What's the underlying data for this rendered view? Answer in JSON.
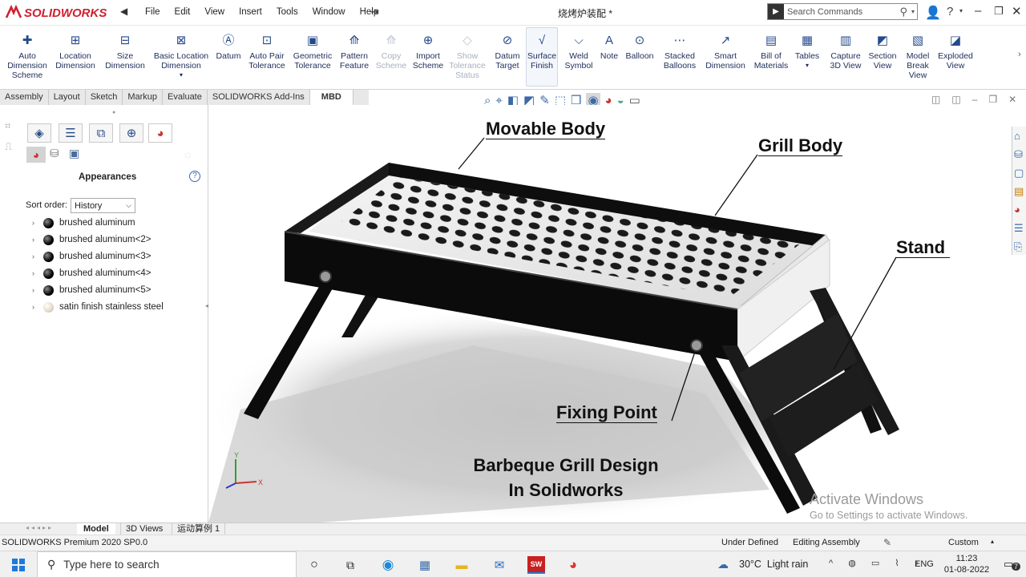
{
  "app": {
    "logo_text": "SOLIDWORKS",
    "document_title": "烧烤炉装配 *",
    "menu": [
      "File",
      "Edit",
      "View",
      "Insert",
      "Tools",
      "Window",
      "Help"
    ],
    "search_placeholder": "Search Commands"
  },
  "command_manager": {
    "tools": [
      {
        "label": "Auto Dimension Scheme",
        "icon": "auto-dimension-icon",
        "disabled": false
      },
      {
        "label": "Location Dimension",
        "icon": "location-dimension-icon",
        "disabled": false
      },
      {
        "label": "Size Dimension",
        "icon": "size-dimension-icon",
        "disabled": false
      },
      {
        "label": "Basic Location Dimension",
        "icon": "basic-location-dimension-icon",
        "disabled": false
      },
      {
        "label": "Datum",
        "icon": "datum-icon",
        "disabled": false
      },
      {
        "label": "Auto Pair Tolerance",
        "icon": "auto-pair-tolerance-icon",
        "disabled": false
      },
      {
        "label": "Geometric Tolerance",
        "icon": "geometric-tolerance-icon",
        "disabled": false
      },
      {
        "label": "Pattern Feature",
        "icon": "pattern-feature-icon",
        "disabled": false
      },
      {
        "label": "Copy Scheme",
        "icon": "copy-scheme-icon",
        "disabled": true
      },
      {
        "label": "Import Scheme",
        "icon": "import-scheme-icon",
        "disabled": false
      },
      {
        "label": "Show Tolerance Status",
        "icon": "show-tolerance-status-icon",
        "disabled": true
      },
      {
        "label": "Datum Target",
        "icon": "datum-target-icon",
        "disabled": false
      },
      {
        "label": "Surface Finish",
        "icon": "surface-finish-icon",
        "disabled": false
      },
      {
        "label": "Weld Symbol",
        "icon": "weld-symbol-icon",
        "disabled": false
      },
      {
        "label": "Note",
        "icon": "note-icon",
        "disabled": false
      },
      {
        "label": "Balloon",
        "icon": "balloon-icon",
        "disabled": false
      },
      {
        "label": "Stacked Balloons",
        "icon": "stacked-balloons-icon",
        "disabled": false
      },
      {
        "label": "Smart Dimension",
        "icon": "smart-dimension-icon",
        "disabled": false
      },
      {
        "label": "Bill of Materials",
        "icon": "bill-of-materials-icon",
        "disabled": false
      },
      {
        "label": "Tables",
        "icon": "tables-icon",
        "disabled": false
      },
      {
        "label": "Capture 3D View",
        "icon": "capture-3d-view-icon",
        "disabled": false
      },
      {
        "label": "Section View",
        "icon": "section-view-icon",
        "disabled": false
      },
      {
        "label": "Model Break View",
        "icon": "model-break-view-icon",
        "disabled": false
      },
      {
        "label": "Exploded View",
        "icon": "exploded-view-icon",
        "disabled": false
      }
    ]
  },
  "tabs": [
    "Assembly",
    "Layout",
    "Sketch",
    "Markup",
    "Evaluate",
    "SOLIDWORKS Add-Ins",
    "MBD"
  ],
  "active_tab": "MBD",
  "panel": {
    "title": "Appearances",
    "sort_label": "Sort order:",
    "sort_value": "History",
    "items": [
      {
        "label": "brushed aluminum",
        "type": "black"
      },
      {
        "label": "brushed aluminum<2>",
        "type": "black"
      },
      {
        "label": "brushed aluminum<3>",
        "type": "black"
      },
      {
        "label": "brushed aluminum<4>",
        "type": "black"
      },
      {
        "label": "brushed aluminum<5>",
        "type": "black"
      },
      {
        "label": "satin finish stainless steel",
        "type": "satin"
      }
    ]
  },
  "viewport": {
    "callouts": {
      "movable_body": "Movable Body",
      "grill_body": "Grill Body",
      "stand": "Stand",
      "fixing_point": "Fixing Point"
    },
    "caption_line1": "Barbeque Grill Design",
    "caption_line2": "In Solidworks",
    "watermark_line1": "Activate Windows",
    "watermark_line2": "Go to Settings to activate Windows.",
    "triad_x": "X",
    "triad_y": "Y"
  },
  "bottom_tabs": [
    "Model",
    "3D Views",
    "运动算例 1"
  ],
  "status": {
    "left": "SOLIDWORKS Premium 2020 SP0.0",
    "state": "Under Defined",
    "mode": "Editing Assembly",
    "units": "Custom"
  },
  "taskbar": {
    "search_placeholder": "Type here to search",
    "weather": "30°C  Light rain",
    "language": "ENG",
    "time": "11:23",
    "date": "01-08-2022",
    "notification_count": "7"
  }
}
